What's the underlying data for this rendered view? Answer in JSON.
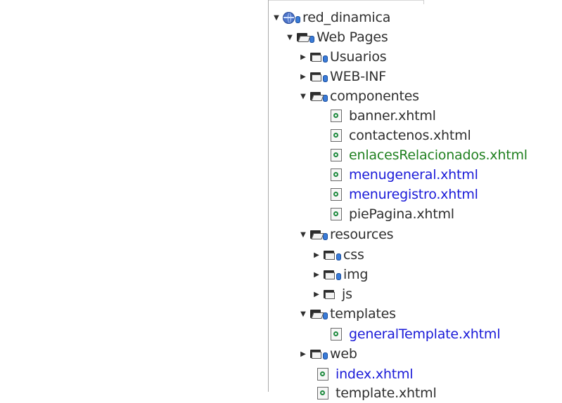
{
  "project_tree": {
    "root": {
      "label": "red_dinamica"
    },
    "web_pages": {
      "label": "Web Pages"
    },
    "usuarios": {
      "label": "Usuarios"
    },
    "web_inf": {
      "label": "WEB-INF"
    },
    "componentes": {
      "label": "componentes",
      "files": [
        "banner.xhtml",
        "contactenos.xhtml",
        "enlacesRelacionados.xhtml",
        "menugeneral.xhtml",
        "menuregistro.xhtml",
        "piePagina.xhtml"
      ]
    },
    "resources": {
      "label": "resources",
      "folders": [
        "css",
        "img",
        "js"
      ]
    },
    "templates": {
      "label": "templates",
      "files": [
        "generalTemplate.xhtml"
      ]
    },
    "web": {
      "label": "web"
    },
    "index": {
      "label": "index.xhtml"
    },
    "partial": {
      "label": "template.xhtml"
    }
  },
  "colors": {
    "modified": "#1a1ad8",
    "new": "#208020",
    "normal": "#2f2f2f"
  }
}
